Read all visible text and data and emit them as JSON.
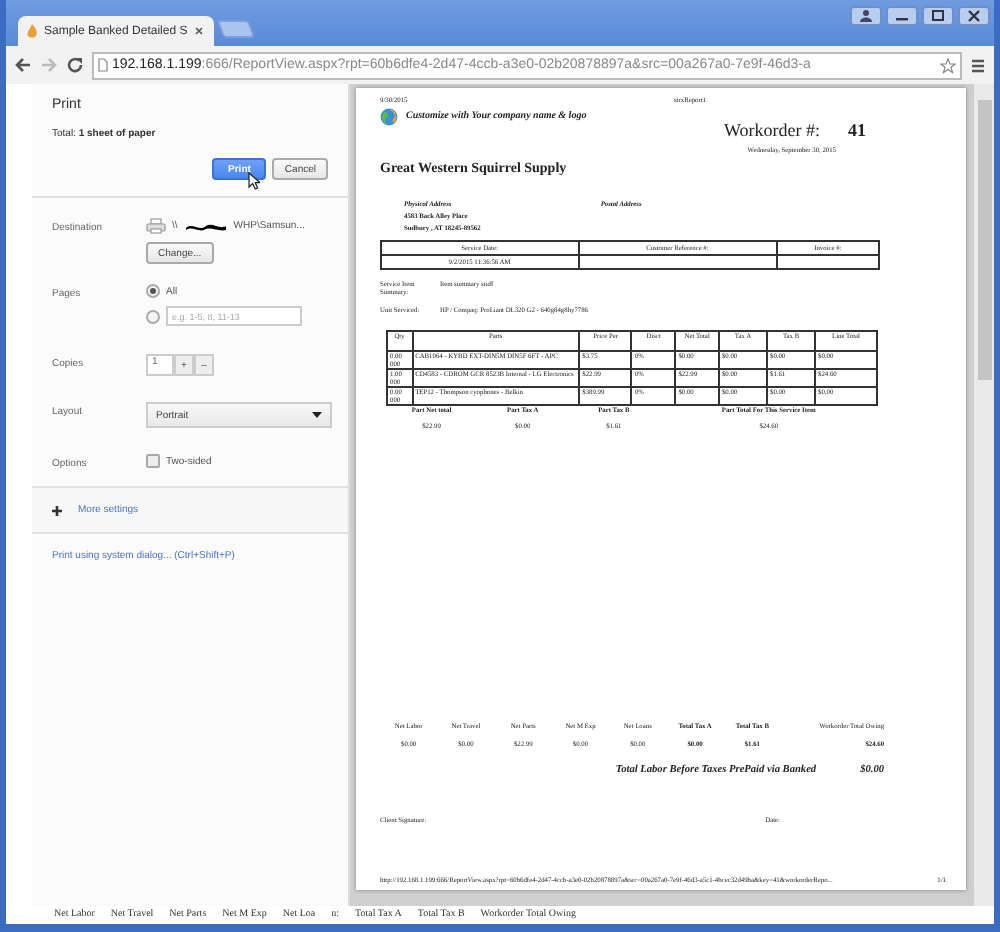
{
  "browser": {
    "tab_title": "Sample Banked Detailed S",
    "address_host": "192.168.1.199",
    "address_path": ":666/ReportView.aspx?rpt=60b6dfe4-2d47-4ccb-a3e0-02b20878897a&src=00a267a0-7e9f-46d3-a"
  },
  "print_panel": {
    "title": "Print",
    "total_label": "Total:",
    "total_value": "1 sheet of paper",
    "buttons": [
      {
        "label": "Print",
        "kind": "primary"
      },
      {
        "label": "Cancel",
        "kind": "secondary"
      }
    ],
    "destination": {
      "label": "Destination",
      "printer_prefix": "\\\\",
      "printer_suffix": "WHP\\Samsun...",
      "change_button": "Change..."
    },
    "pages": {
      "label": "Pages",
      "options": [
        {
          "kind": "all",
          "label": "All",
          "selected": true
        },
        {
          "kind": "range",
          "placeholder": "e.g. 1-5, 8, 11-13",
          "selected": false
        }
      ]
    },
    "copies": {
      "label": "Copies",
      "value": "1",
      "plus": "+",
      "minus": "–"
    },
    "layout": {
      "label": "Layout",
      "value": "Portrait"
    },
    "options": {
      "label": "Options",
      "items": [
        {
          "label": "Two-sided",
          "checked": false
        }
      ]
    },
    "more_settings": "More settings",
    "system_dialog_link": "Print using system dialog... (Ctrl+Shift+P)"
  },
  "report": {
    "print_date": "9/30/2015",
    "report_name": "strxReport1",
    "tagline": "Customize with Your company name & logo",
    "workorder_label": "Workorder #:",
    "workorder_number": "41",
    "long_date": "Wednesday, September 30, 2015",
    "company": "Great Western Squirrel Supply",
    "physical_address_label": "Physical Address",
    "address_lines": [
      "4583 Back Alley Place",
      "Sudbury , AT  18245-89562"
    ],
    "postal_address_label": "Postal Address",
    "service_table": {
      "columns": [
        "Service Date:",
        "Customer Reference #:",
        "Invoice #:"
      ],
      "service_date": "9/2/2015 11:36:56 AM"
    },
    "service_item_label": "Service Item Summary:",
    "service_item_value": "Item summary stuff",
    "unit_label": "Unit Serviced:",
    "unit_value": "HP / Compaq: ProLiant DL320 G2 - 640g84g8hy7786",
    "parts_table": {
      "columns": [
        "Qty",
        "Parts",
        "Price Per",
        "Disct",
        "Net Total",
        "Tax A",
        "Tax B",
        "Line Total"
      ],
      "rows": [
        [
          "0.00 000",
          "CAB1064 - KYBD EXT-DIN5M DIN5F 6FT - APC",
          "$3.75",
          "0%",
          "$0.00",
          "$0.00",
          "$0.00",
          "$0.00"
        ],
        [
          "1.00 000",
          "CD4583 - CDROM GCR 8523B Internal - LG Electronics",
          "$22.99",
          "0%",
          "$22.99",
          "$0.00",
          "$1.61",
          "$24.60"
        ],
        [
          "0.00 000",
          "TEP12 - Thompson cyophones - Belkin",
          "$389.99",
          "0%",
          "$0.00",
          "$0.00",
          "$0.00",
          "$0.00"
        ]
      ]
    },
    "part_totals": {
      "labels": [
        "Part Net total",
        "Part Tax A",
        "Part Tax B",
        "Part Total For This Service Item"
      ],
      "values": [
        "$22.99",
        "$0.00",
        "$1.61",
        "$24.60"
      ]
    },
    "summary": {
      "labels": [
        "Net Labor",
        "Net Travel",
        "Net Parts",
        "Net M Exp",
        "Net Loans",
        "Total Tax A",
        "Total Tax B",
        "Workorder Total Owing"
      ],
      "values": [
        "$0.00",
        "$0.00",
        "$22.99",
        "$0.00",
        "$0.00",
        "$0.00",
        "$1.61",
        "$24.60"
      ]
    },
    "prepaid_label": "Total Labor Before Taxes PrePaid via Banked",
    "prepaid_value": "$0.00",
    "signature_label": "Client Signature:",
    "date_label": "Date:",
    "footer_url": "http://192.168.1.199:666/ReportView.aspx?rpt=60b6dfe4-2d47-4ccb-a3e0-02b20878897a&src=00a267a0-7e9f-46d3-a5c1-4bcec32d49ba&key=41&workorderRepo...",
    "footer_page": "1/1"
  },
  "background_strip": [
    "Net Labor",
    "Net Travel",
    "Net Parts",
    "Net M Exp",
    "Net Loa",
    "n:",
    "Total Tax A",
    "Total Tax B",
    "Workorder Total Owing"
  ]
}
